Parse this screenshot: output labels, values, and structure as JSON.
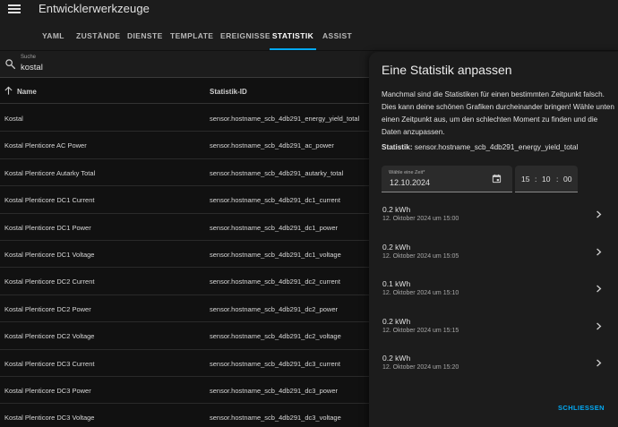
{
  "header": {
    "title": "Entwicklerwerkzeuge"
  },
  "tabs": [
    {
      "label": "YAML"
    },
    {
      "label": "ZUSTÄNDE"
    },
    {
      "label": "DIENSTE"
    },
    {
      "label": "TEMPLATE"
    },
    {
      "label": "EREIGNISSE"
    },
    {
      "label": "STATISTIK"
    },
    {
      "label": "ASSIST"
    }
  ],
  "search": {
    "label": "Suche",
    "value": "kostal"
  },
  "table": {
    "columns": {
      "name": "Name",
      "statistic_id": "Statistik-ID"
    },
    "rows": [
      {
        "name": "Kostal",
        "sid": "sensor.hostname_scb_4db291_energy_yield_total"
      },
      {
        "name": "Kostal Plenticore AC Power",
        "sid": "sensor.hostname_scb_4db291_ac_power"
      },
      {
        "name": "Kostal Plenticore Autarky Total",
        "sid": "sensor.hostname_scb_4db291_autarky_total"
      },
      {
        "name": "Kostal Plenticore DC1 Current",
        "sid": "sensor.hostname_scb_4db291_dc1_current"
      },
      {
        "name": "Kostal Plenticore DC1 Power",
        "sid": "sensor.hostname_scb_4db291_dc1_power"
      },
      {
        "name": "Kostal Plenticore DC1 Voltage",
        "sid": "sensor.hostname_scb_4db291_dc1_voltage"
      },
      {
        "name": "Kostal Plenticore DC2 Current",
        "sid": "sensor.hostname_scb_4db291_dc2_current"
      },
      {
        "name": "Kostal Plenticore DC2 Power",
        "sid": "sensor.hostname_scb_4db291_dc2_power"
      },
      {
        "name": "Kostal Plenticore DC2 Voltage",
        "sid": "sensor.hostname_scb_4db291_dc2_voltage"
      },
      {
        "name": "Kostal Plenticore DC3 Current",
        "sid": "sensor.hostname_scb_4db291_dc3_current"
      },
      {
        "name": "Kostal Plenticore DC3 Power",
        "sid": "sensor.hostname_scb_4db291_dc3_power"
      },
      {
        "name": "Kostal Plenticore DC3 Voltage",
        "sid": "sensor.hostname_scb_4db291_dc3_voltage"
      }
    ]
  },
  "dialog": {
    "title": "Eine Statistik anpassen",
    "description": "Manchmal sind die Statistiken für einen bestimmten Zeitpunkt falsch. Dies kann deine schönen Grafiken durcheinander bringen! Wähle unten einen Zeitpunkt aus, um den schlechten Moment zu finden und die Daten anzupassen.",
    "statistic_label": "Statistik:",
    "statistic_id": "sensor.hostname_scb_4db291_energy_yield_total",
    "date_label": "Wähle eine Zeit*",
    "date_value": "12.10.2024",
    "time": {
      "hours": "15",
      "minutes": "10",
      "seconds": "00",
      "separator": ":"
    },
    "entries": [
      {
        "value": "0.2 kWh",
        "date": "12. Oktober 2024 um 15:00"
      },
      {
        "value": "0.2 kWh",
        "date": "12. Oktober 2024 um 15:05"
      },
      {
        "value": "0.1 kWh",
        "date": "12. Oktober 2024 um 15:10"
      },
      {
        "value": "0.2 kWh",
        "date": "12. Oktober 2024 um 15:15"
      },
      {
        "value": "0.2 kWh",
        "date": "12. Oktober 2024 um 15:20"
      }
    ],
    "close_label": "SCHLIESSEN"
  },
  "colors": {
    "accent": "#03a9f4",
    "background": "#111111",
    "surface": "#1c1c1c"
  },
  "icons": [
    "menu-icon",
    "search-icon",
    "arrow-up-icon",
    "calendar-icon",
    "chevron-right-icon"
  ]
}
